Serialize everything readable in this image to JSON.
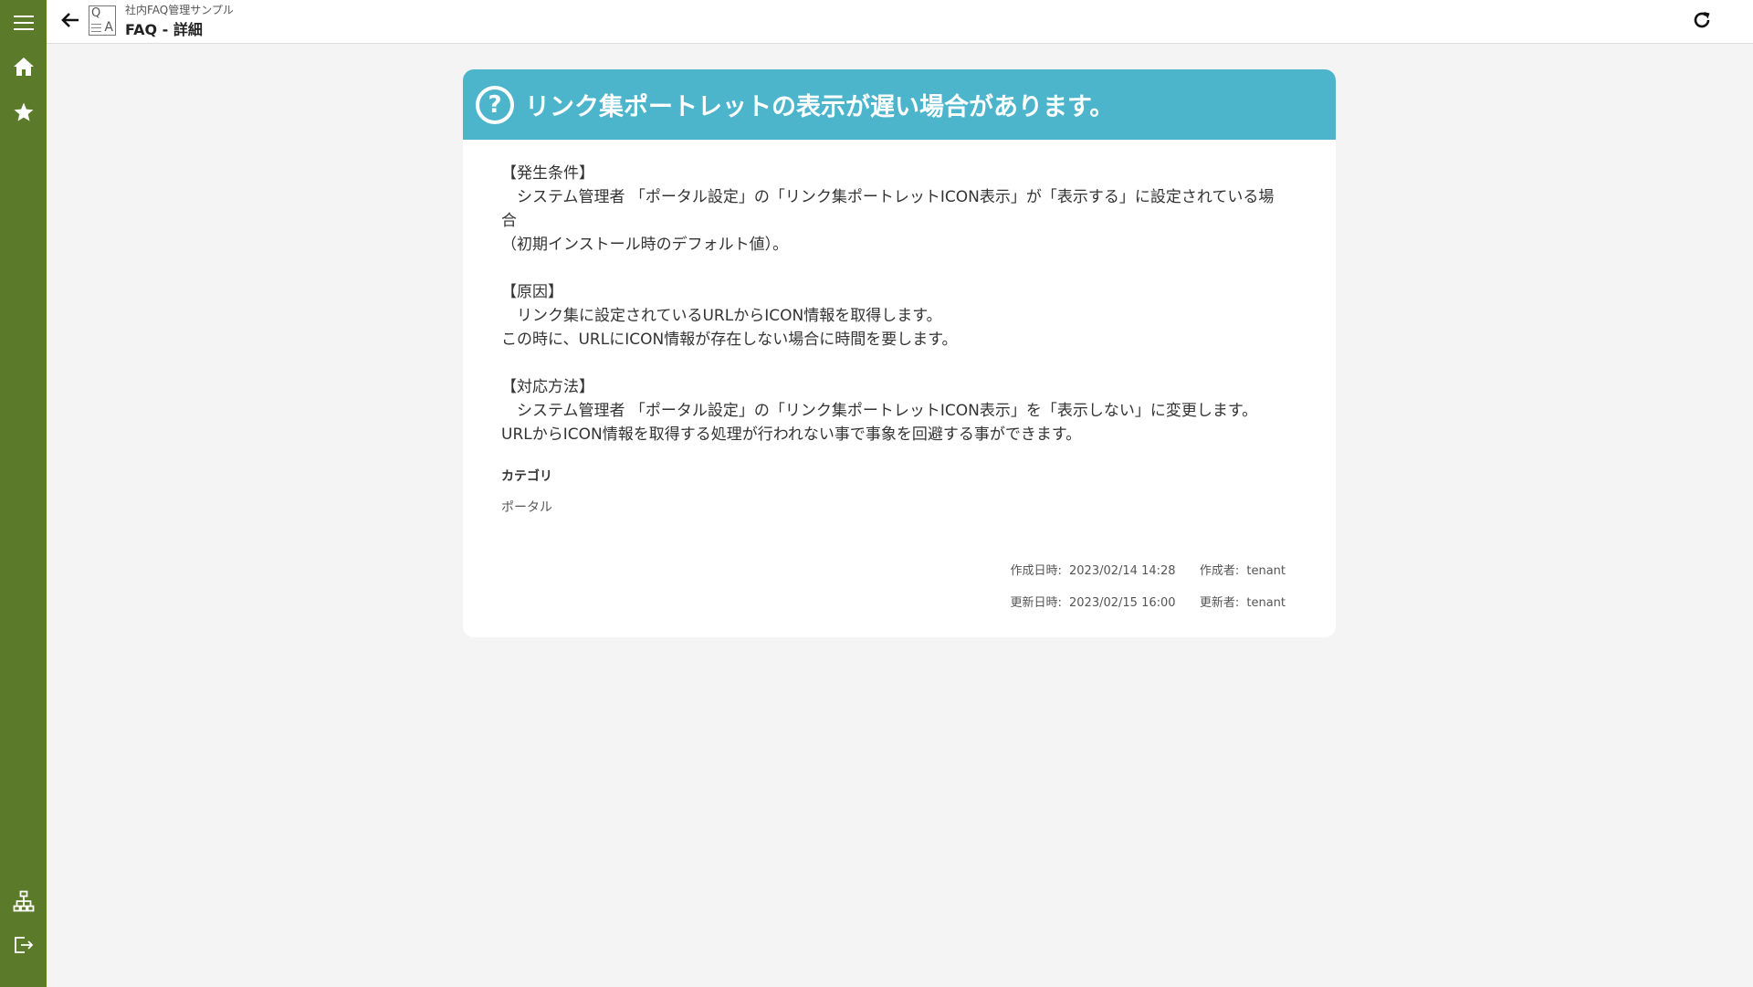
{
  "header": {
    "app_name": "社内FAQ管理サンプル",
    "page_title": "FAQ - 詳細"
  },
  "sidebar": {
    "top_items": [
      {
        "icon": "menu-icon"
      },
      {
        "icon": "home-icon"
      },
      {
        "icon": "star-icon"
      }
    ],
    "bottom_items": [
      {
        "icon": "sitemap-icon"
      },
      {
        "icon": "logout-icon"
      }
    ]
  },
  "faq": {
    "title": "リンク集ポートレットの表示が遅い場合があります。",
    "sections": [
      {
        "heading": "【発生条件】",
        "lines": [
          "　システム管理者 「ポータル設定」の「リンク集ポートレットICON表示」が「表示する」に設定されている場",
          "合",
          "（初期インストール時のデフォルト値）。"
        ]
      },
      {
        "heading": "【原因】",
        "lines": [
          "　リンク集に設定されているURLからICON情報を取得します。",
          "この時に、URLにICON情報が存在しない場合に時間を要します。"
        ]
      },
      {
        "heading": "【対応方法】",
        "lines": [
          "　システム管理者 「ポータル設定」の「リンク集ポートレットICON表示」を「表示しない」に変更します。",
          "URLからICON情報を取得する処理が行われない事で事象を回避する事ができます。"
        ]
      }
    ],
    "category_label": "カテゴリ",
    "category_value": "ポータル",
    "created_label": "作成日時:",
    "created_at": "2023/02/14 14:28",
    "creator_label": "作成者:",
    "creator": "tenant",
    "updated_label": "更新日時:",
    "updated_at": "2023/02/15 16:00",
    "updater_label": "更新者:",
    "updater": "tenant"
  },
  "colors": {
    "sidebar": "#5b7a2a",
    "card_header": "#4db5cb",
    "background": "#f4f4f4"
  }
}
